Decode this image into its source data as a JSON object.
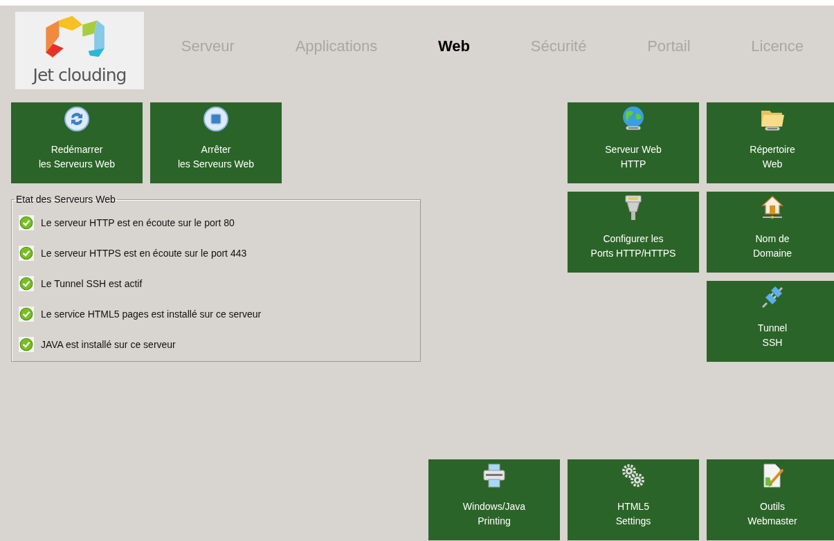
{
  "logo": {
    "text": "Jet clouding"
  },
  "tabs": [
    {
      "label": "Serveur",
      "selected": false
    },
    {
      "label": "Applications",
      "selected": false
    },
    {
      "label": "Web",
      "selected": true
    },
    {
      "label": "Sécurité",
      "selected": false
    },
    {
      "label": "Portail",
      "selected": false
    },
    {
      "label": "Licence",
      "selected": false
    }
  ],
  "actions": [
    {
      "lines": [
        "Redémarrer",
        "les Serveurs Web"
      ]
    },
    {
      "lines": [
        "Arrêter",
        "les Serveurs Web"
      ]
    }
  ],
  "status_panel": {
    "title": "Etat des Serveurs Web",
    "items": [
      {
        "text": "Le serveur HTTP est en écoute sur le port 80",
        "ok": true
      },
      {
        "text": "Le serveur HTTPS est en écoute sur le port 443",
        "ok": true
      },
      {
        "text": "Le Tunnel SSH est actif",
        "ok": true
      },
      {
        "text": "Le service HTML5 pages est installé sur ce serveur",
        "ok": true
      },
      {
        "text": "JAVA est installé sur ce serveur",
        "ok": true
      }
    ]
  },
  "tiles": [
    {
      "lines": [
        "Serveur Web",
        "HTTP"
      ]
    },
    {
      "lines": [
        "Répertoire",
        "Web"
      ]
    },
    {
      "lines": [
        "Configurer les",
        "Ports HTTP/HTTPS"
      ]
    },
    {
      "lines": [
        "Nom de",
        "Domaine"
      ]
    },
    {
      "lines": [
        "Tunnel",
        "SSH"
      ]
    },
    {
      "lines": [
        "Windows/Java",
        "Printing"
      ]
    },
    {
      "lines": [
        "HTML5",
        "Settings"
      ]
    },
    {
      "lines": [
        "Outils",
        "Webmaster"
      ]
    }
  ]
}
